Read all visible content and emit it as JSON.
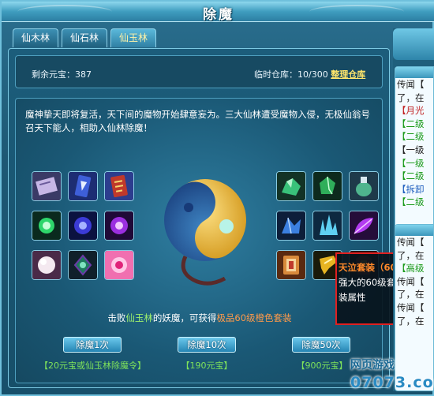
{
  "window": {
    "title": "除魔"
  },
  "tabs": [
    {
      "label": "仙木林"
    },
    {
      "label": "仙石林"
    },
    {
      "label": "仙玉林"
    }
  ],
  "status": {
    "balance_label": "剩余元宝：",
    "balance_value": "387",
    "warehouse_label": "临时仓库：",
    "warehouse_value": "10/300",
    "warehouse_link": "整理仓库"
  },
  "description": "魔神挚天即将复活，天下间的魔物开始肆意妄为。三大仙林遭受魔物入侵，无极仙翁号召天下能人，相助入仙林除魔！",
  "reward": {
    "prefix": "击败",
    "forest": "仙玉林",
    "middle": "的妖魔，可获得",
    "item": "极品60级橙色套装"
  },
  "actions": [
    {
      "label": "除魔1次",
      "cost": "【20元宝或仙玉林除魔令】"
    },
    {
      "label": "除魔10次",
      "cost": "【190元宝】"
    },
    {
      "label": "除魔50次",
      "cost": "【900元宝】"
    }
  ],
  "tooltip": {
    "title": "天泣套装（60级",
    "line1": "强大的60级套装，",
    "line2": "装属性"
  },
  "side_panel": {
    "box1": [
      "传闻【",
      "了，在",
      "【月光",
      "【二级",
      "【二级",
      "【一级",
      "【一级",
      "【二级",
      "【拆卸",
      "【二级"
    ],
    "box2": [
      "传闻【",
      "了，在",
      "【高级",
      "传闻【",
      "了，在",
      "",
      "",
      "",
      "传闻【",
      "了，在"
    ]
  },
  "logo": {
    "name": "网页游戏",
    "number": "07073.com"
  },
  "colors": {
    "accent": "#7cc9e3",
    "link": "#ffe66b",
    "highlight_green": "#9ef06c",
    "highlight_orange": "#ff9a4a",
    "tooltip_border": "#e02020"
  }
}
